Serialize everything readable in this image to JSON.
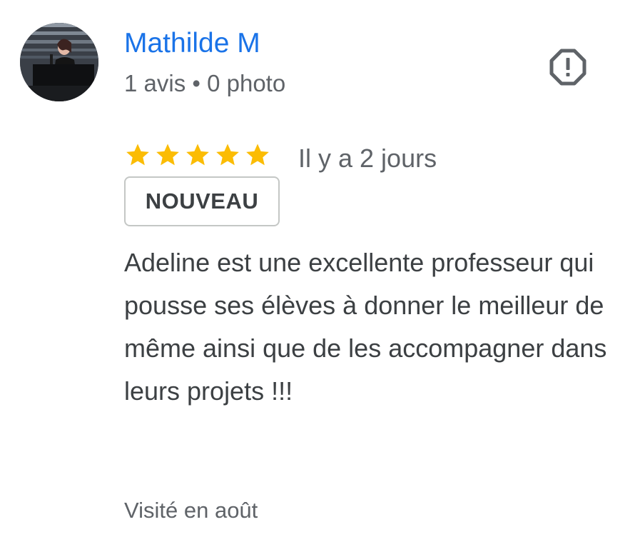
{
  "author": {
    "name": "Mathilde M",
    "meta": "1 avis • 0 photo",
    "avatar": "avatar-photo"
  },
  "report": {
    "icon": "report-octagon-icon"
  },
  "review": {
    "rating": 5,
    "rating_max": 5,
    "star_color": "#fbbc04",
    "date": "Il y a 2 jours",
    "badge": "NOUVEAU",
    "text": "Adeline est une excellente professeur qui pousse ses élèves à donner le meilleur de même ainsi que de les accompagner dans leurs projets !!!",
    "visit": "Visité en août"
  },
  "colors": {
    "author_link": "#1a73e8",
    "secondary_text": "#5f6368",
    "primary_text": "#3c4043"
  }
}
